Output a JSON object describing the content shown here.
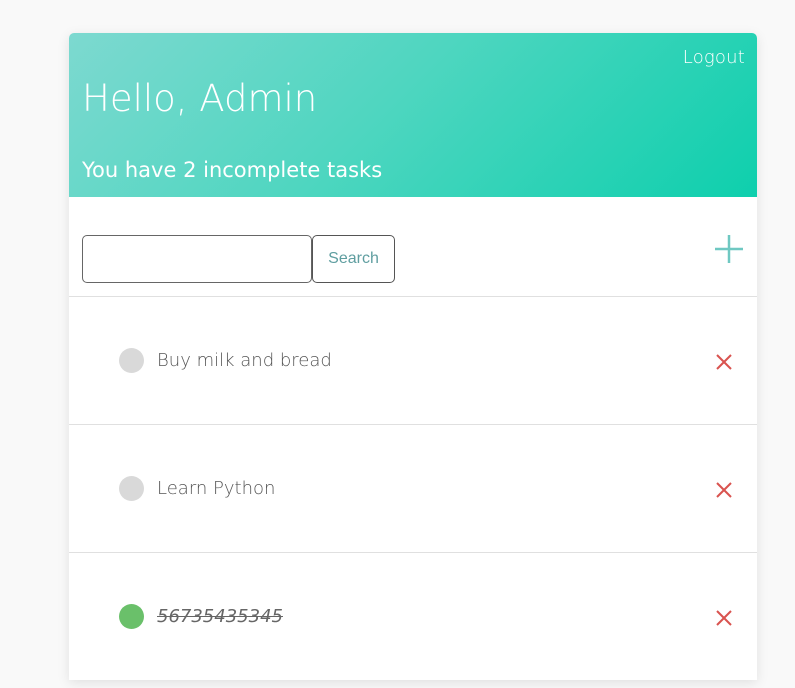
{
  "header": {
    "logout_label": "Logout",
    "greeting": "Hello, Admin",
    "subtitle": "You have 2 incomplete tasks"
  },
  "search": {
    "value": "",
    "placeholder": "",
    "button_label": "Search"
  },
  "add_icon": "plus-icon",
  "tasks": [
    {
      "text": "Buy milk and bread",
      "completed": false
    },
    {
      "text": "Learn Python",
      "completed": false
    },
    {
      "text": "56735435345",
      "completed": true
    }
  ],
  "colors": {
    "header_gradient_start": "#7dd9d0",
    "header_gradient_end": "#0ecfad",
    "incomplete_dot": "#d9d9d9",
    "complete_dot": "#6ac06a",
    "delete": "#d9534f",
    "accent": "#5fc9c0"
  }
}
